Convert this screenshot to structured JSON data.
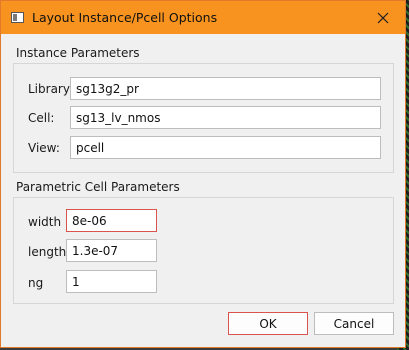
{
  "window": {
    "title": "Layout Instance/Pcell Options"
  },
  "instance_parameters": {
    "heading": "Instance Parameters",
    "library_label": "Library:",
    "library_value": "sg13g2_pr",
    "cell_label": "Cell:",
    "cell_value": "sg13_lv_nmos",
    "view_label": "View:",
    "view_value": "pcell"
  },
  "pcell_parameters": {
    "heading": "Parametric Cell Parameters",
    "width_label": "width",
    "width_value": "8e-06",
    "length_label": "length",
    "length_value": "1.3e-07",
    "ng_label": "ng",
    "ng_value": "1"
  },
  "buttons": {
    "ok_label": "OK",
    "cancel_label": "Cancel"
  },
  "colors": {
    "titlebar": "#f7931e",
    "focus_border": "#d9534f"
  },
  "icons": {
    "app": "window-icon",
    "close": "close-icon"
  }
}
